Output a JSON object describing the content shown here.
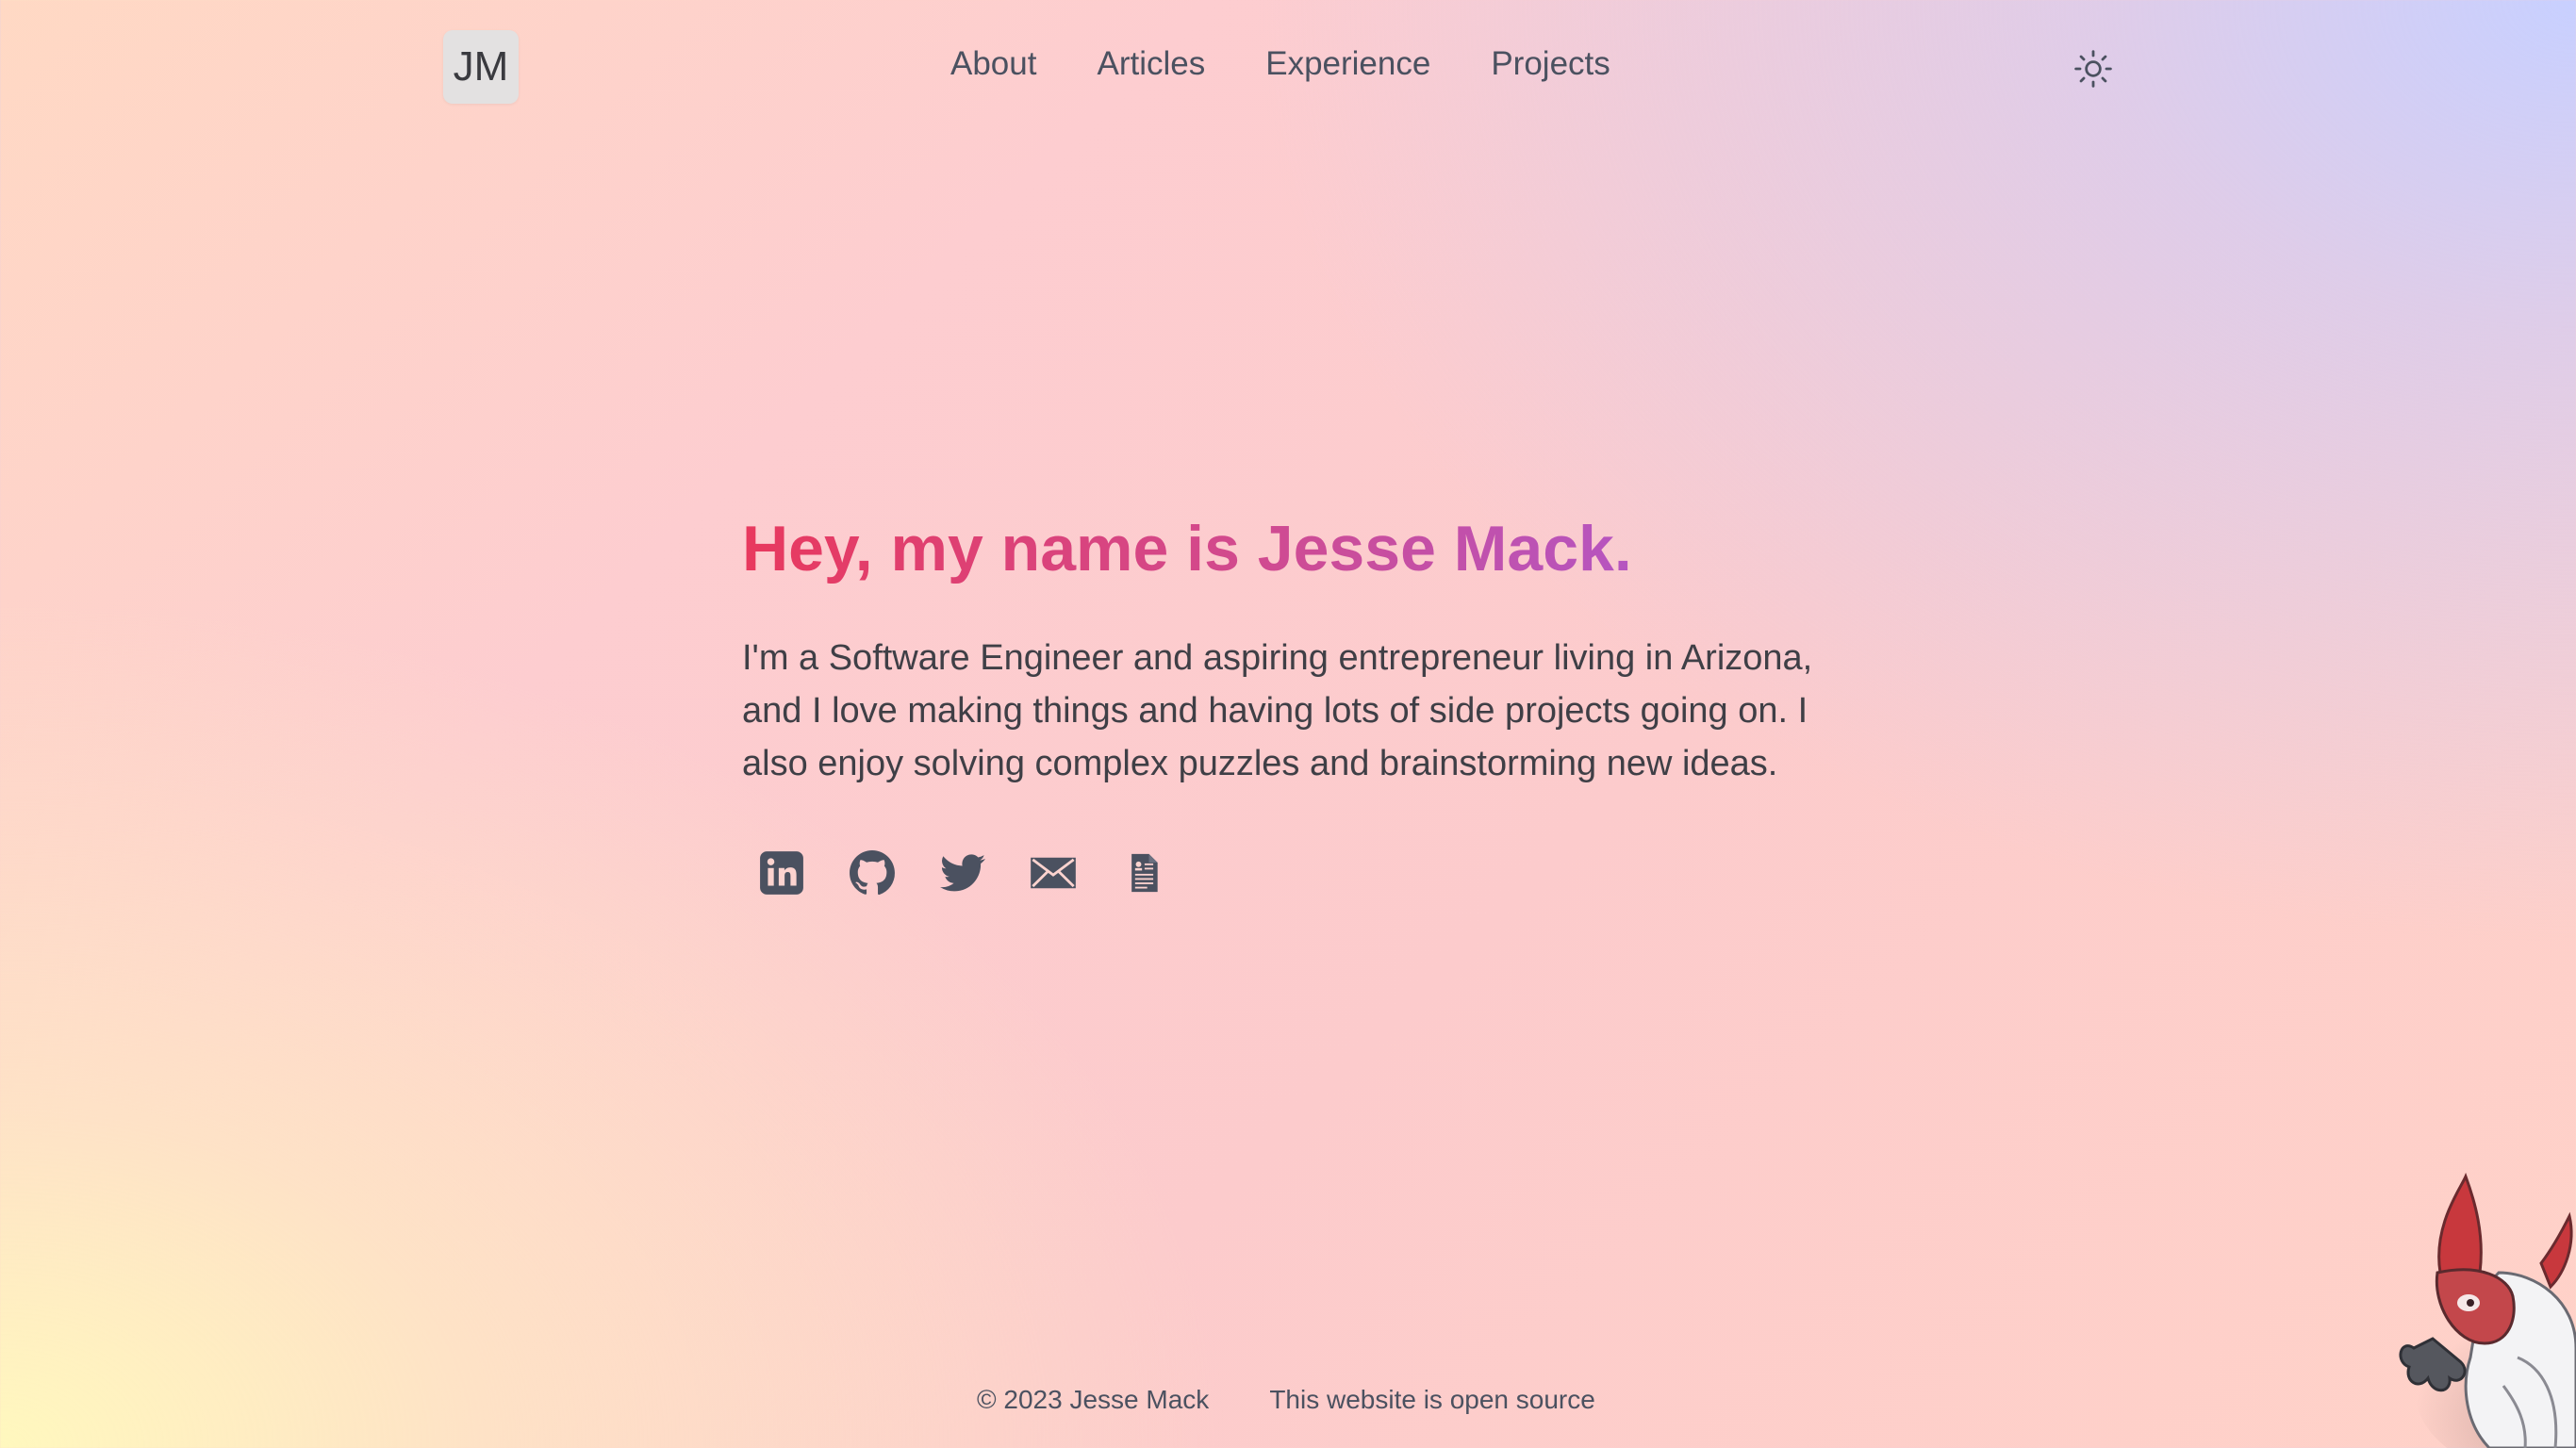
{
  "header": {
    "logo_text": "JM",
    "nav": [
      {
        "label": "About"
      },
      {
        "label": "Articles"
      },
      {
        "label": "Experience"
      },
      {
        "label": "Projects"
      }
    ],
    "theme_icon": "sun-icon"
  },
  "hero": {
    "title": "Hey, my name is Jesse Mack.",
    "intro": "I'm a Software Engineer and aspiring entrepreneur living in Arizona, and I love making things and having lots of side projects going on. I also enjoy solving complex puzzles and brainstorming new ideas.",
    "socials": [
      "linkedin-icon",
      "github-icon",
      "twitter-icon",
      "email-icon",
      "resume-icon"
    ]
  },
  "footer": {
    "copyright": "© 2023 Jesse Mack",
    "source_link": "This website is open source"
  },
  "colors": {
    "heading_start": "#e8395e",
    "heading_end": "#a45ce0",
    "text": "#3f3f46",
    "icon": "#4b5160"
  }
}
